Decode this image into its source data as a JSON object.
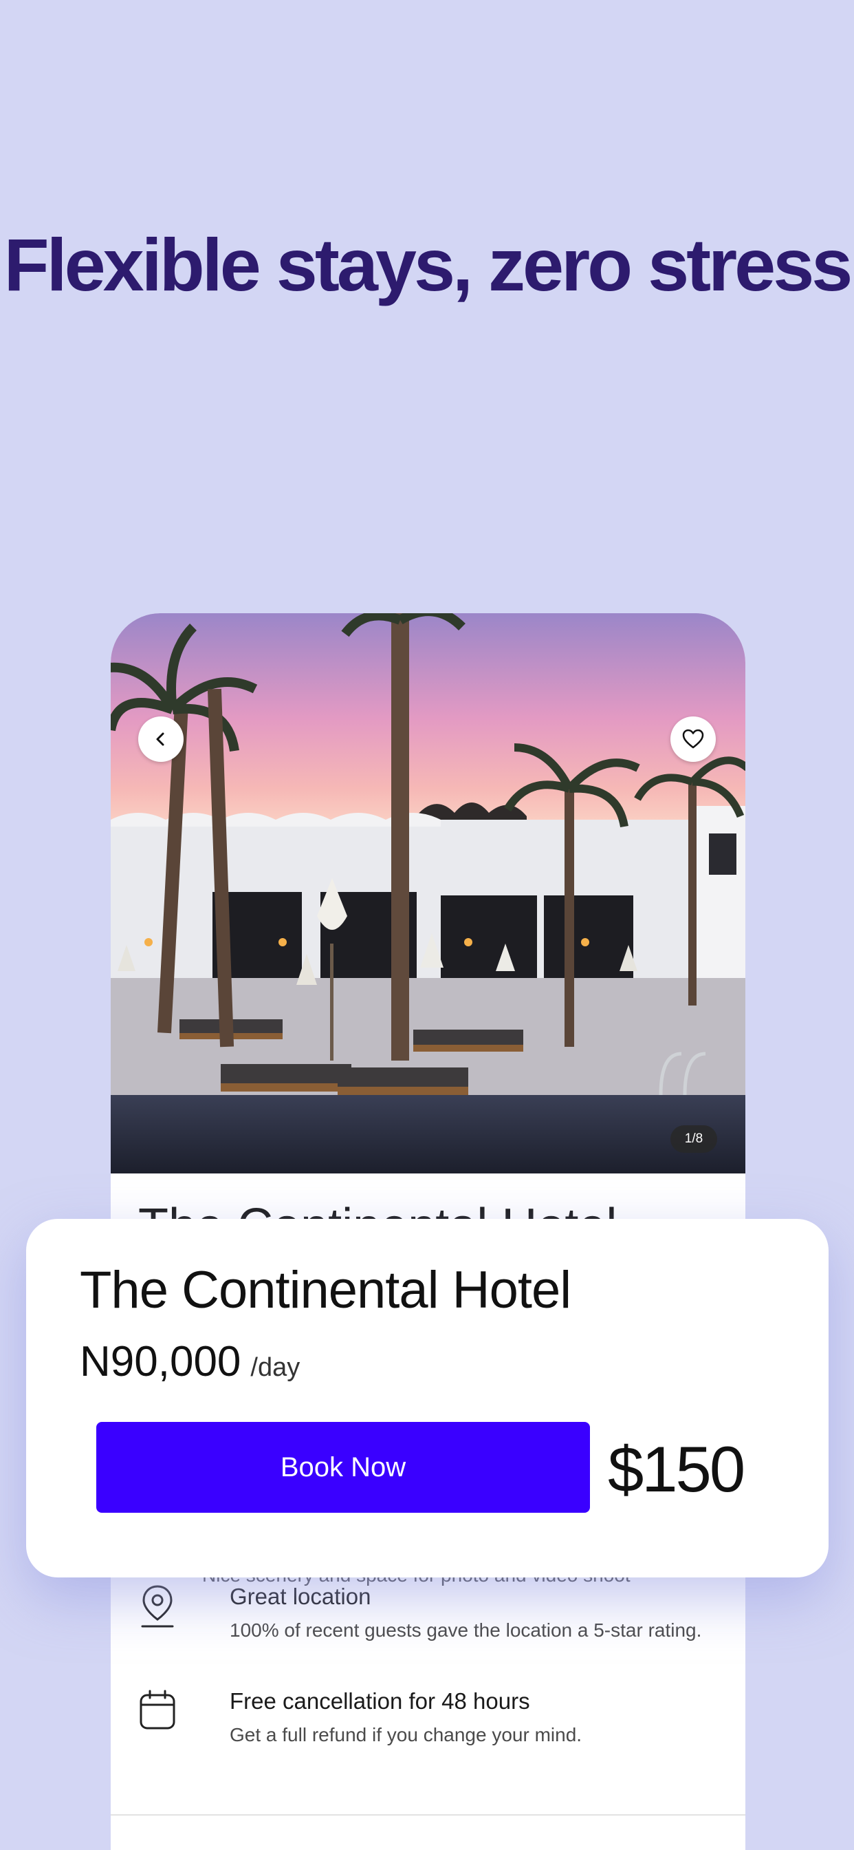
{
  "headline": "Flexible stays, zero stress",
  "listing": {
    "image_counter": "1/8",
    "peek_title": "The Continental Hotel",
    "peek_feature_desc": "Nice scenery and space for photo and video shoot",
    "features": [
      {
        "icon": "location-pin-icon",
        "title": "Great location",
        "description": "100% of recent guests gave the location a 5-star rating."
      },
      {
        "icon": "calendar-icon",
        "title": "Free cancellation for 48 hours",
        "description": "Get a full refund if you change your mind."
      }
    ]
  },
  "booking": {
    "hotel_name": "The Continental Hotel",
    "price": "N90,000",
    "price_unit": "/day",
    "button_label": "Book Now",
    "usd_price": "$150"
  },
  "colors": {
    "background": "#d3d6f4",
    "headline": "#2d1b6e",
    "primary_button": "#3a00ff"
  }
}
